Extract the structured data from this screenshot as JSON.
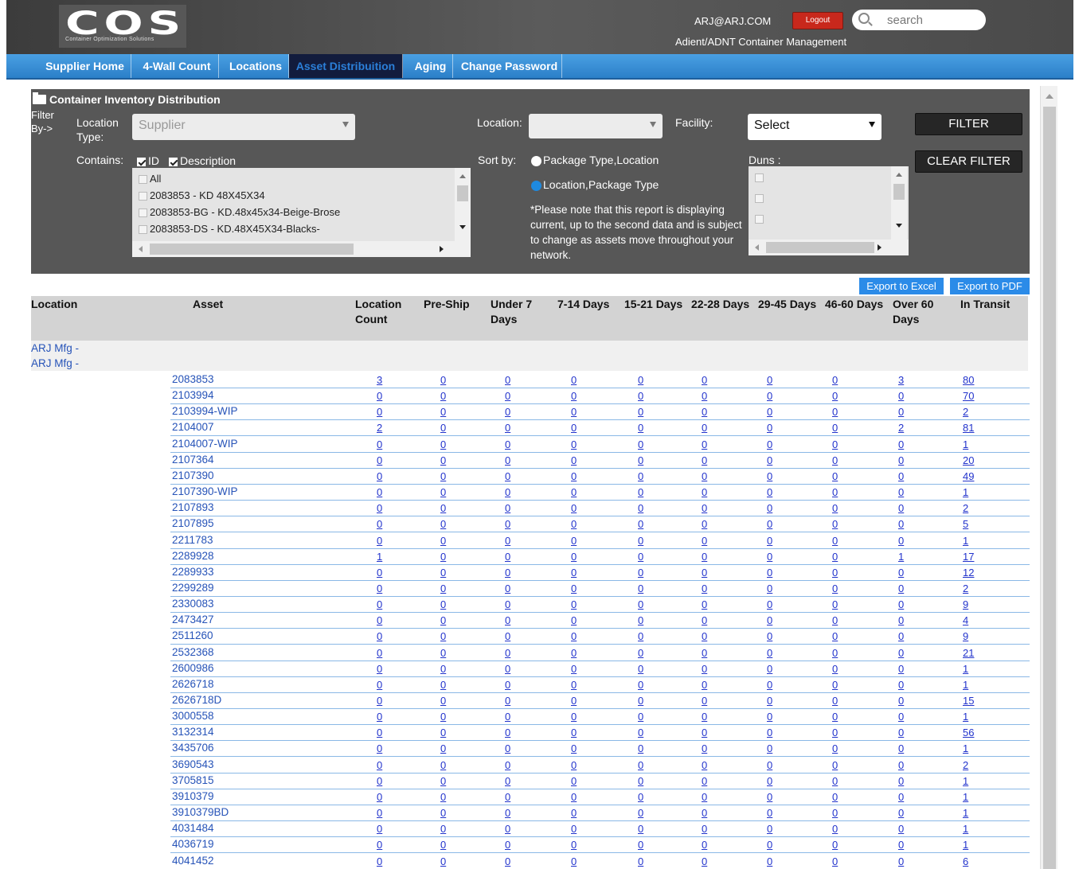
{
  "header": {
    "logo_text": "COS",
    "logo_subtitle": "Container Optimization Solutions",
    "user_email": "ARJ@ARJ.COM",
    "logout_label": "Logout",
    "search_placeholder": "search",
    "company": "Adient/ADNT Container Management"
  },
  "nav": {
    "items": [
      "Supplier Home",
      "4-Wall Count",
      "Locations",
      "Asset Distribuition",
      "Aging",
      "Change Password"
    ],
    "active": "Asset Distribuition"
  },
  "filter": {
    "title": "Container Inventory Distribution",
    "filter_by_1": "Filter",
    "filter_by_2": "By->",
    "location_type_1": "Location",
    "location_type_2": "Type:",
    "location_type_value": "Supplier",
    "location_label": "Location:",
    "location_value": "",
    "facility_label": "Facility:",
    "facility_value": "Select",
    "filter_button": "FILTER",
    "clear_filter_button": "CLEAR FILTER",
    "contains_label": "Contains:",
    "contains_id": "ID",
    "contains_description": "Description",
    "list_items": [
      "All",
      "2083853 - KD 48X45X34",
      "2083853-BG - KD.48x45x34-Beige-Brose",
      "2083853-DS - KD.48X45X34-Blacks-"
    ],
    "sort_by_label": "Sort by:",
    "sort_option_1": "Package Type,Location",
    "sort_option_2": "Location,Package Type",
    "note": "*Please note that this report is displaying current, up to the second data and is subject to change as assets move throughout your network.",
    "duns_label": "Duns :"
  },
  "export": {
    "excel": "Export to Excel",
    "pdf": "Export to PDF"
  },
  "table": {
    "headers": {
      "location": "Location",
      "asset": "Asset",
      "location_count_1": "Location",
      "location_count_2": "Count",
      "pre_ship": "Pre-Ship",
      "under7_1": "Under 7",
      "under7_2": "Days",
      "d7_14": "7-14 Days",
      "d15_21": "15-21 Days",
      "d22_28": "22-28 Days",
      "d29_45": "29-45 Days",
      "d46_60": "46-60 Days",
      "over60_1": "Over 60",
      "over60_2": "Days",
      "in_transit": "In Transit"
    },
    "group_line_1": "ARJ Mfg -",
    "group_line_2": "ARJ Mfg -",
    "rows": [
      [
        "2083853",
        "3",
        "0",
        "0",
        "0",
        "0",
        "0",
        "0",
        "0",
        "3",
        "80"
      ],
      [
        "2103994",
        "0",
        "0",
        "0",
        "0",
        "0",
        "0",
        "0",
        "0",
        "0",
        "70"
      ],
      [
        "2103994-WIP",
        "0",
        "0",
        "0",
        "0",
        "0",
        "0",
        "0",
        "0",
        "0",
        "2"
      ],
      [
        "2104007",
        "2",
        "0",
        "0",
        "0",
        "0",
        "0",
        "0",
        "0",
        "2",
        "81"
      ],
      [
        "2104007-WIP",
        "0",
        "0",
        "0",
        "0",
        "0",
        "0",
        "0",
        "0",
        "0",
        "1"
      ],
      [
        "2107364",
        "0",
        "0",
        "0",
        "0",
        "0",
        "0",
        "0",
        "0",
        "0",
        "20"
      ],
      [
        "2107390",
        "0",
        "0",
        "0",
        "0",
        "0",
        "0",
        "0",
        "0",
        "0",
        "49"
      ],
      [
        "2107390-WIP",
        "0",
        "0",
        "0",
        "0",
        "0",
        "0",
        "0",
        "0",
        "0",
        "1"
      ],
      [
        "2107893",
        "0",
        "0",
        "0",
        "0",
        "0",
        "0",
        "0",
        "0",
        "0",
        "2"
      ],
      [
        "2107895",
        "0",
        "0",
        "0",
        "0",
        "0",
        "0",
        "0",
        "0",
        "0",
        "5"
      ],
      [
        "2211783",
        "0",
        "0",
        "0",
        "0",
        "0",
        "0",
        "0",
        "0",
        "0",
        "1"
      ],
      [
        "2289928",
        "1",
        "0",
        "0",
        "0",
        "0",
        "0",
        "0",
        "0",
        "1",
        "17"
      ],
      [
        "2289933",
        "0",
        "0",
        "0",
        "0",
        "0",
        "0",
        "0",
        "0",
        "0",
        "12"
      ],
      [
        "2299289",
        "0",
        "0",
        "0",
        "0",
        "0",
        "0",
        "0",
        "0",
        "0",
        "2"
      ],
      [
        "2330083",
        "0",
        "0",
        "0",
        "0",
        "0",
        "0",
        "0",
        "0",
        "0",
        "9"
      ],
      [
        "2473427",
        "0",
        "0",
        "0",
        "0",
        "0",
        "0",
        "0",
        "0",
        "0",
        "4"
      ],
      [
        "2511260",
        "0",
        "0",
        "0",
        "0",
        "0",
        "0",
        "0",
        "0",
        "0",
        "9"
      ],
      [
        "2532368",
        "0",
        "0",
        "0",
        "0",
        "0",
        "0",
        "0",
        "0",
        "0",
        "21"
      ],
      [
        "2600986",
        "0",
        "0",
        "0",
        "0",
        "0",
        "0",
        "0",
        "0",
        "0",
        "1"
      ],
      [
        "2626718",
        "0",
        "0",
        "0",
        "0",
        "0",
        "0",
        "0",
        "0",
        "0",
        "1"
      ],
      [
        "2626718D",
        "0",
        "0",
        "0",
        "0",
        "0",
        "0",
        "0",
        "0",
        "0",
        "15"
      ],
      [
        "3000558",
        "0",
        "0",
        "0",
        "0",
        "0",
        "0",
        "0",
        "0",
        "0",
        "1"
      ],
      [
        "3132314",
        "0",
        "0",
        "0",
        "0",
        "0",
        "0",
        "0",
        "0",
        "0",
        "56"
      ],
      [
        "3435706",
        "0",
        "0",
        "0",
        "0",
        "0",
        "0",
        "0",
        "0",
        "0",
        "1"
      ],
      [
        "3690543",
        "0",
        "0",
        "0",
        "0",
        "0",
        "0",
        "0",
        "0",
        "0",
        "2"
      ],
      [
        "3705815",
        "0",
        "0",
        "0",
        "0",
        "0",
        "0",
        "0",
        "0",
        "0",
        "1"
      ],
      [
        "3910379",
        "0",
        "0",
        "0",
        "0",
        "0",
        "0",
        "0",
        "0",
        "0",
        "1"
      ],
      [
        "3910379BD",
        "0",
        "0",
        "0",
        "0",
        "0",
        "0",
        "0",
        "0",
        "0",
        "1"
      ],
      [
        "4031484",
        "0",
        "0",
        "0",
        "0",
        "0",
        "0",
        "0",
        "0",
        "0",
        "1"
      ],
      [
        "4036719",
        "0",
        "0",
        "0",
        "0",
        "0",
        "0",
        "0",
        "0",
        "0",
        "1"
      ],
      [
        "4041452",
        "0",
        "0",
        "0",
        "0",
        "0",
        "0",
        "0",
        "0",
        "0",
        "6"
      ]
    ]
  },
  "colors": {
    "nav_blue": "#2b7fc8",
    "header_gray": "#4a4a4a",
    "logout_red": "#c8281c",
    "link_blue": "#2233cc",
    "export_blue": "#2b8be8"
  }
}
